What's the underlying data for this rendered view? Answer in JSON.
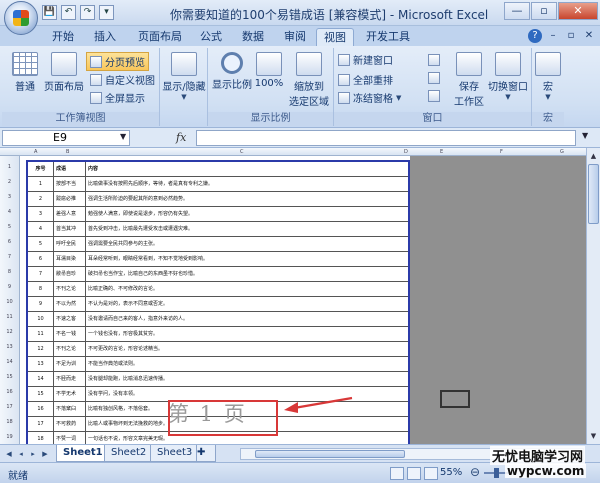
{
  "window": {
    "title": "你需要知道的100个易错成语  [兼容模式] - Microsoft Excel",
    "minimize": "—",
    "restore": "▫",
    "close": "✕"
  },
  "qat": [
    "💾",
    "↶",
    "↷",
    "▾"
  ],
  "tabs": [
    "开始",
    "插入",
    "页面布局",
    "公式",
    "数据",
    "审阅",
    "视图",
    "开发工具"
  ],
  "active_tab": "视图",
  "ribbon": {
    "workbook_views": {
      "label": "工作簿视图",
      "normal": "普通",
      "page_layout": "页面布局",
      "page_break_preview": "分页预览",
      "custom_views": "自定义视图",
      "full_screen": "全屏显示"
    },
    "show_hide": {
      "label": "显示/隐藏"
    },
    "zoom": {
      "label": "显示比例",
      "zoom": "显示比例",
      "hundred": "100%",
      "zoom_to_selection_1": "缩放到",
      "zoom_to_selection_2": "选定区域"
    },
    "window": {
      "label": "窗口",
      "new_window": "新建窗口",
      "arrange_all": "全部重排",
      "freeze_panes": "冻结窗格",
      "save_workspace_1": "保存",
      "save_workspace_2": "工作区",
      "switch_windows": "切换窗口"
    },
    "macros": {
      "label": "宏",
      "macros": "宏"
    }
  },
  "formula_bar": {
    "name_box": "E9",
    "fx": "fx",
    "value": ""
  },
  "columns": [
    "A",
    "B",
    "C",
    "D",
    "E",
    "F",
    "G"
  ],
  "table": {
    "headers": [
      "序号",
      "成语",
      "内容"
    ],
    "rows": [
      [
        "1",
        "按部不当",
        "比喻做事没有按照先后顺序，等待，者是真有专利之嫌。"
      ],
      [
        "2",
        "跋扈必推",
        "强调生活所阶迫的要起其所的意到必然趋势。"
      ],
      [
        "3",
        "差强人意",
        "勉强使人满意，即使说是退步，形容仍有失望。"
      ],
      [
        "4",
        "首当其冲",
        "首先受到冲击，比喻最先遭受攻击或遭遇灾难。"
      ],
      [
        "5",
        "呼吁全民",
        "强调需要全民共同参与的主张。"
      ],
      [
        "6",
        "耳濡目染",
        "耳朵经常听到，眼睛经常看到，不知不觉地受到影响。"
      ],
      [
        "7",
        "敝帚自珍",
        "破扫帚也当作宝，比喻自己的东西虽不好也珍惜。"
      ],
      [
        "8",
        "不刊之论",
        "比喻正确的、不可修改的言论。"
      ],
      [
        "9",
        "不以为然",
        "不认为是对的，表示不同意或否定。"
      ],
      [
        "10",
        "不速之客",
        "没有邀请而自己来的客人，指意外来访的人。"
      ],
      [
        "11",
        "不名一钱",
        "一个钱也没有，形容极其贫穷。"
      ],
      [
        "12",
        "不刊之论",
        "不可更改的言论，形容论述精当。"
      ],
      [
        "13",
        "不足为训",
        "不能当作典范或法则。"
      ],
      [
        "14",
        "不胫而走",
        "没有腿却能跑，比喻消息迅速传播。"
      ],
      [
        "15",
        "不学无术",
        "没有学问，没有本领。"
      ],
      [
        "16",
        "不落窠臼",
        "比喻有独创风格，不落俗套。"
      ],
      [
        "17",
        "不可救药",
        "比喻人或事物坏到无法挽救的地步。"
      ],
      [
        "18",
        "不赞一词",
        "一句话也不说，形容文章完美无瑕。"
      ],
      [
        "19",
        "不足为外",
        "不值得外人知道。"
      ]
    ]
  },
  "page_watermark": "第 1 页",
  "sheet_tabs": [
    "Sheet1",
    "Sheet2",
    "Sheet3"
  ],
  "active_sheet": "Sheet1",
  "status": {
    "ready": "就绪",
    "zoom": "55%"
  },
  "site_watermark": {
    "line1": "无忧电脑学习网",
    "line2": "wypcw.com"
  }
}
